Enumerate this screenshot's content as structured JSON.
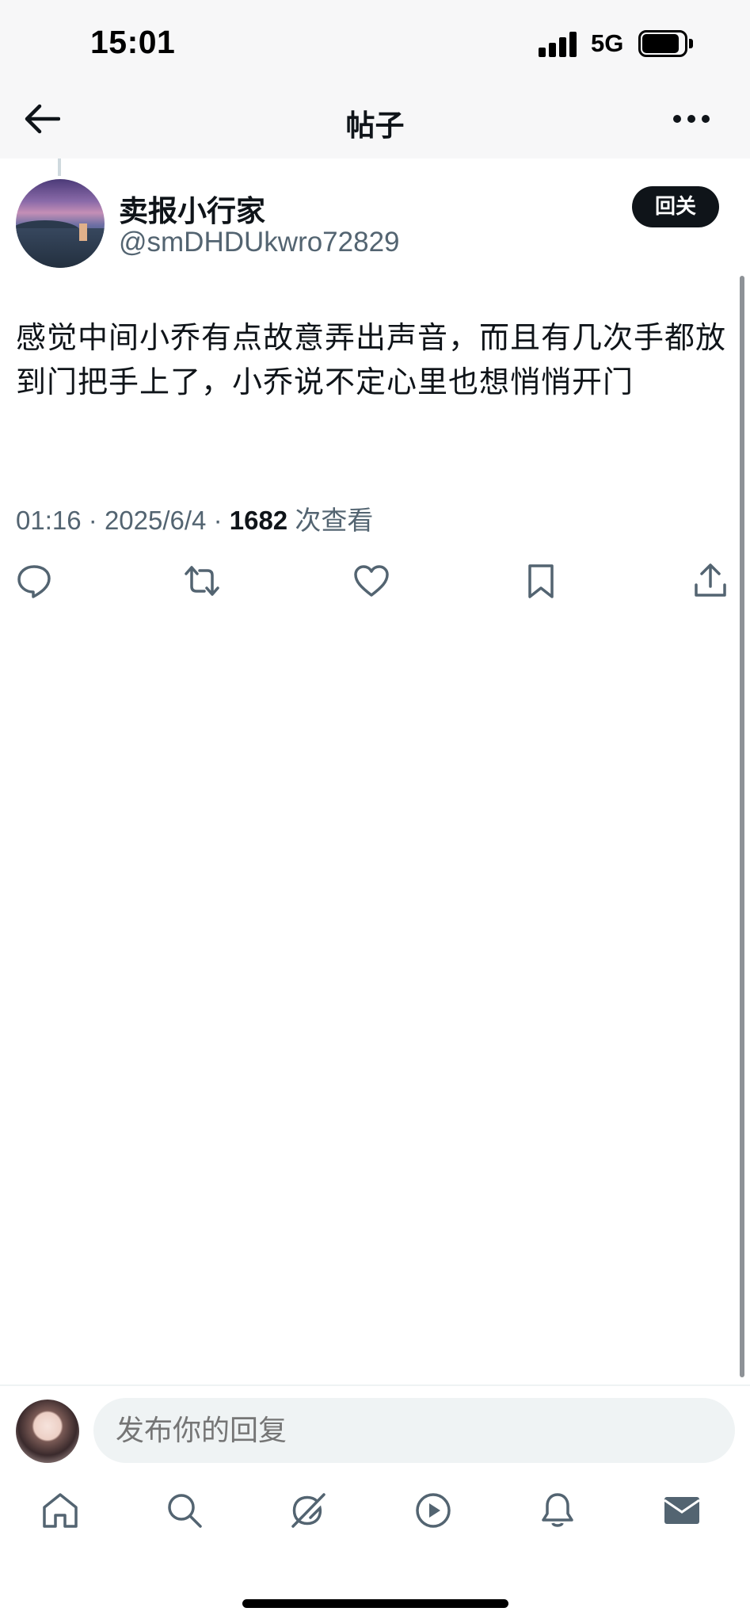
{
  "status_bar": {
    "time": "15:01",
    "network": "5G",
    "signal_icon": "signal-bars-icon",
    "battery_icon": "battery-icon"
  },
  "header": {
    "title": "帖子",
    "back_icon": "back-arrow-icon",
    "more_icon": "more-dots-icon"
  },
  "post": {
    "author_name": "卖报小行家",
    "author_handle": "@smDHDUkwro72829",
    "follow_label": "回关",
    "text": "感觉中间小乔有点故意弄出声音，而且有几次手都放到门把手上了，小乔说不定心里也想悄悄开门",
    "time": "01:16",
    "date": "2025/6/4",
    "sep": "·",
    "views_count": "1682",
    "views_label": "次查看",
    "actions": [
      "reply-icon",
      "retweet-icon",
      "like-icon",
      "bookmark-icon",
      "share-icon"
    ]
  },
  "reply_bar": {
    "placeholder": "发布你的回复"
  },
  "tabbar": {
    "items": [
      "home-icon",
      "search-icon",
      "grok-icon",
      "video-icon",
      "notifications-icon",
      "messages-icon"
    ]
  },
  "colors": {
    "text": "#0f1419",
    "secondary": "#536471",
    "input_bg": "#eff3f4"
  }
}
